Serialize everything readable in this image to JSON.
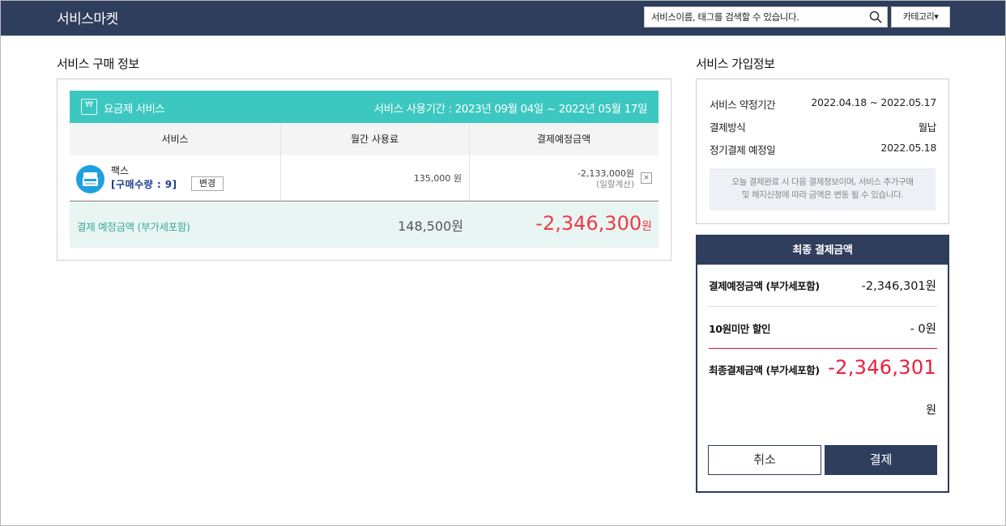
{
  "header": {
    "brand": "서비스마켓",
    "search_placeholder": "서비스이름, 태그를 검색할 수 있습니다.",
    "category_label": "카테고리▾"
  },
  "purchase": {
    "title": "서비스 구매 정보",
    "plan": {
      "icon_glyph": "₩",
      "name": "요금제 서비스",
      "period": "서비스 사용기간 : 2023년 09월 04일 ~ 2022년 05월 17일"
    },
    "columns": [
      "서비스",
      "월간 사용료",
      "결제예정금액"
    ],
    "row": {
      "icon": "fax-icon",
      "name": "팩스",
      "quantity": "[구매수량 : 9]",
      "change_label": "변경",
      "monthly_fee": "135,000 원",
      "expected_amount": "-2,133,000원",
      "prorated_note": "(일할계산)",
      "remove_label": "×"
    },
    "summary": {
      "label": "결제 예정금액 (부가세포함)",
      "monthly_total": "148,500원",
      "expected_total": "-2,346,300",
      "expected_unit": "원"
    }
  },
  "subscription": {
    "title": "서비스 가입정보",
    "items": [
      {
        "label": "서비스 약정기간",
        "value": "2022.04.18 ~ 2022.05.17"
      },
      {
        "label": "결제방식",
        "value": "월납"
      },
      {
        "label": "정기결제 예정일",
        "value": "2022.05.18"
      }
    ],
    "notice_line1": "오늘 결제완료 시 다음 결제정보이며, 서비스 추가구매",
    "notice_line2": "및 해지신청에 따라 금액은 변동 될 수 있습니다."
  },
  "final": {
    "title": "최종 결제금액",
    "expected_label": "결제예정금액 (부가세포함)",
    "expected_value": "-2,346,301원",
    "discount_label": "10원미만 할인",
    "discount_value": "- 0원",
    "total_label": "최종결제금액 (부가세포함)",
    "total_value": "-2,346,301",
    "total_unit": "원",
    "cancel_label": "취소",
    "pay_label": "결제"
  },
  "colors": {
    "navy": "#2e3e5c",
    "teal": "#3cc8c0",
    "red": "#ee3b47"
  }
}
